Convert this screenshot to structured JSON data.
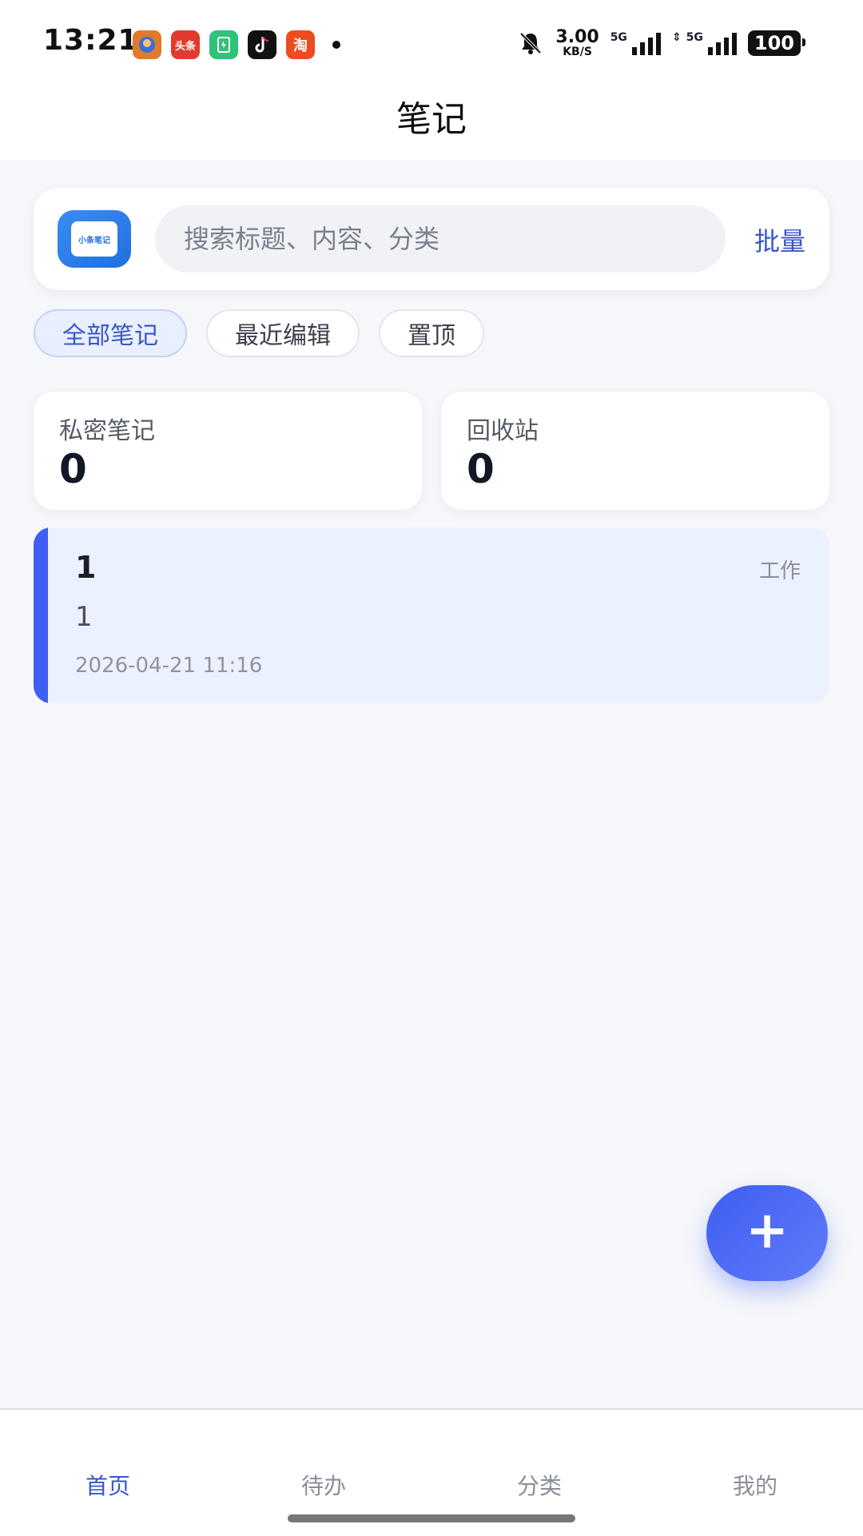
{
  "status_bar": {
    "time": "13:21",
    "apps": [
      {
        "icon": "game-app-icon",
        "text": "",
        "color": "#e07a2a"
      },
      {
        "icon": "toutiao-app-icon",
        "text": "头条",
        "color": "#e23a2e"
      },
      {
        "icon": "green-app-icon",
        "text": "",
        "color": "#2fc27a"
      },
      {
        "icon": "tiktok-app-icon",
        "text": "",
        "color": "#111111"
      },
      {
        "icon": "taobao-app-icon",
        "text": "淘",
        "color": "#ee4b20"
      }
    ],
    "net_speed_value": "3.00",
    "net_speed_unit": "KB/S",
    "signal_label_1": "5G",
    "signal_label_2": "5G",
    "battery": "100"
  },
  "header": {
    "title": "笔记"
  },
  "search": {
    "logo_text": "小条笔记",
    "placeholder": "搜索标题、内容、分类",
    "batch_label": "批量"
  },
  "filters": [
    {
      "label": "全部笔记",
      "active": true
    },
    {
      "label": "最近编辑",
      "active": false
    },
    {
      "label": "置顶",
      "active": false
    }
  ],
  "stats": {
    "private": {
      "label": "私密笔记",
      "value": "0"
    },
    "trash": {
      "label": "回收站",
      "value": "0"
    }
  },
  "notes": [
    {
      "title": "1",
      "category": "工作",
      "body": "1",
      "time": "2026-04-21 11:16"
    }
  ],
  "fab": {
    "label": "+"
  },
  "bottom_nav": [
    {
      "label": "首页",
      "active": true
    },
    {
      "label": "待办",
      "active": false
    },
    {
      "label": "分类",
      "active": false
    },
    {
      "label": "我的",
      "active": false
    }
  ],
  "colors": {
    "accent": "#3f5ef3",
    "link": "#3857c7",
    "note_bg": "#ebf1fe"
  }
}
